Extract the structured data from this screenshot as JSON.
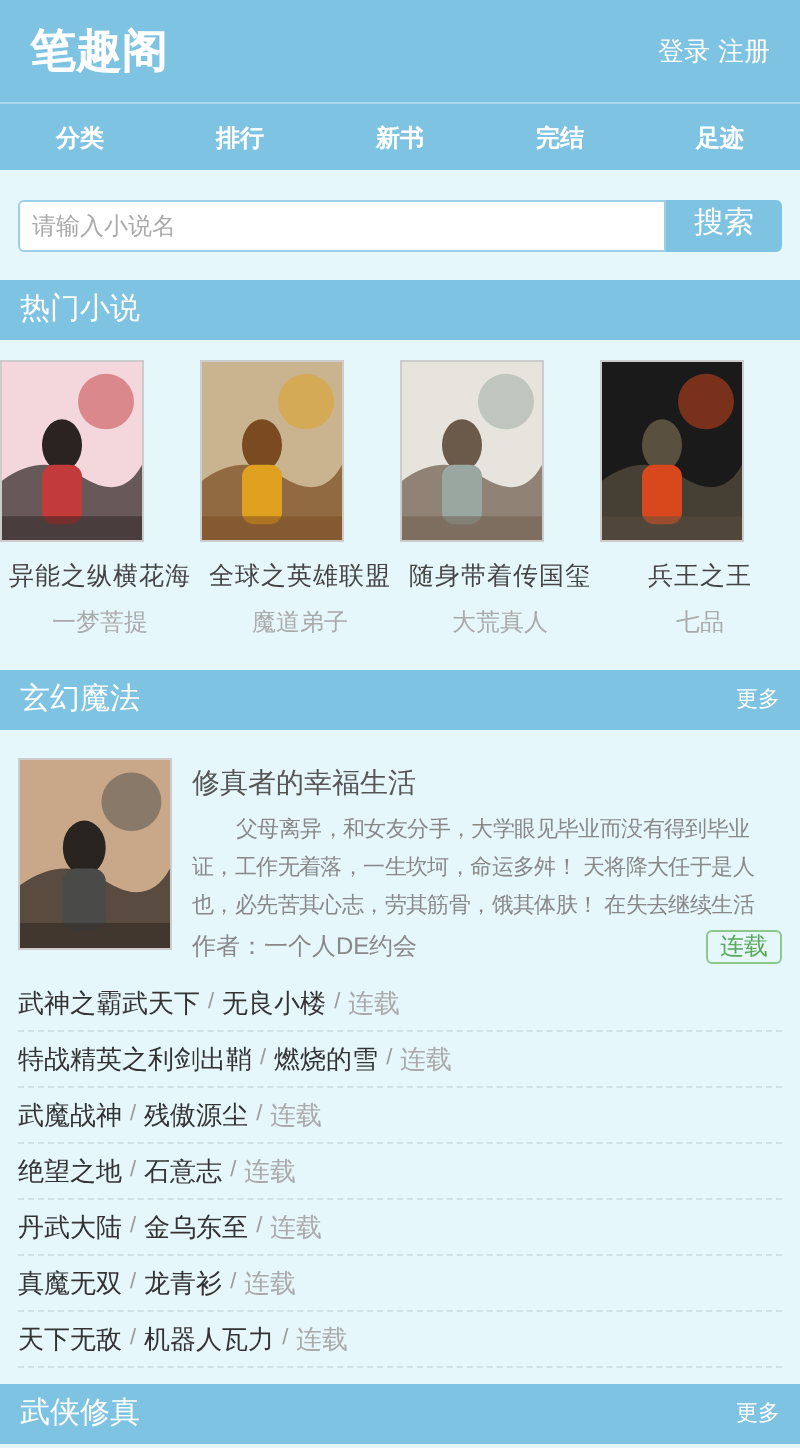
{
  "header": {
    "logo": "笔趣阁",
    "login": "登录",
    "register": "注册"
  },
  "nav": [
    {
      "label": "分类"
    },
    {
      "label": "排行"
    },
    {
      "label": "新书"
    },
    {
      "label": "完结"
    },
    {
      "label": "足迹"
    }
  ],
  "search": {
    "placeholder": "请输入小说名",
    "button": "搜索"
  },
  "hot": {
    "title": "热门小说",
    "books": [
      {
        "title": "异能之纵横花海",
        "author": "一梦菩提",
        "kind": "picture"
      },
      {
        "title": "全球之英雄联盟",
        "author": "魔道弟子",
        "kind": "picture"
      },
      {
        "title": "随身带着传国玺",
        "author": "大荒真人",
        "kind": "picture"
      },
      {
        "title": "兵王之王",
        "author": "七品",
        "kind": "picture"
      }
    ]
  },
  "sections": [
    {
      "title": "玄幻魔法",
      "more": "更多",
      "featured": {
        "title": "修真者的幸福生活",
        "description": "父母离异，和女友分手，大学眼见毕业而没有得到毕业证，工作无着落，一生坎坷，命运多舛！ 天将降大任于是人也，必先苦其心志，劳其筋骨，饿其体肤！ 在失去继续生活",
        "author": "作者：一个人DE约会",
        "status": "连载",
        "kind": "picture"
      },
      "rows": [
        {
          "title": "武神之霸武天下",
          "sep_1": "/",
          "author": "无良小楼",
          "sep_2": "/",
          "status": "连载"
        },
        {
          "title": "特战精英之利剑出鞘",
          "sep_1": "/",
          "author": "燃烧的雪",
          "sep_2": "/",
          "status": "连载"
        },
        {
          "title": "武魔战神",
          "sep_1": "/",
          "author": "残傲源尘",
          "sep_2": "/",
          "status": "连载"
        },
        {
          "title": "绝望之地",
          "sep_1": "/",
          "author": "石意志",
          "sep_2": "/",
          "status": "连载"
        },
        {
          "title": "丹武大陆",
          "sep_1": "/",
          "author": "金乌东至",
          "sep_2": "/",
          "status": "连载"
        },
        {
          "title": "真魔无双",
          "sep_1": "/",
          "author": "龙青衫",
          "sep_2": "/",
          "status": "连载"
        },
        {
          "title": "天下无敌",
          "sep_1": "/",
          "author": "机器人瓦力",
          "sep_2": "/",
          "status": "连载"
        }
      ]
    },
    {
      "title": "武侠修真",
      "more": "更多"
    }
  ]
}
